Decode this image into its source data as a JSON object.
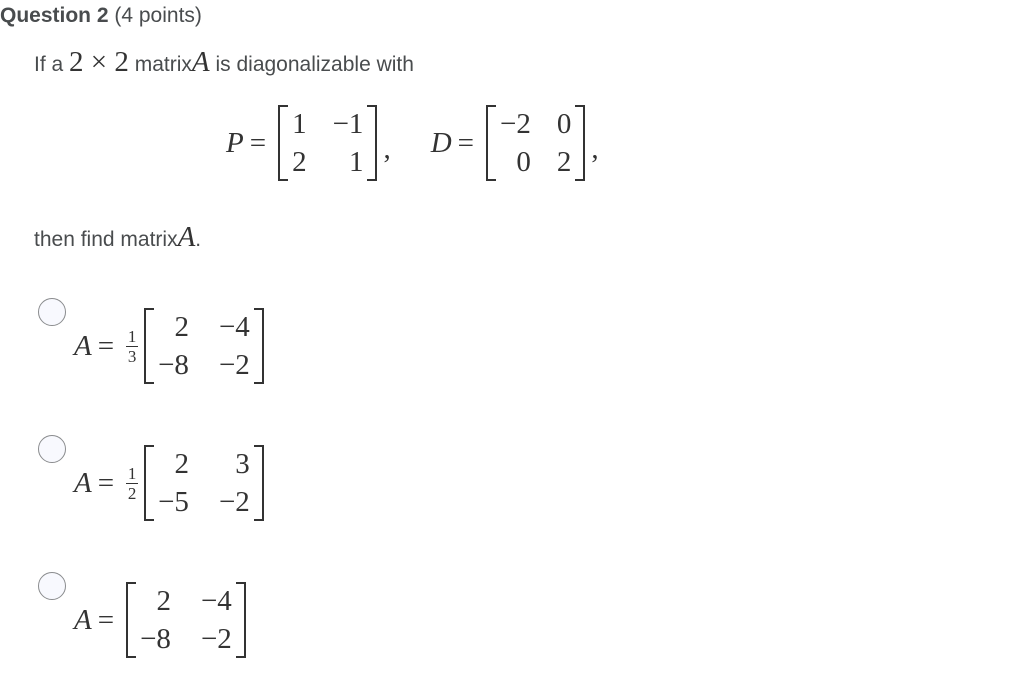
{
  "question": {
    "label": "Question 2",
    "points": "(4 points)"
  },
  "prompt": {
    "pre": "If a",
    "dims": "2 × 2",
    "mid": "matrix",
    "var": "A",
    "post": "is diagonalizable with"
  },
  "given": {
    "P": {
      "name": "P",
      "equals": "=",
      "rows": [
        [
          "1",
          "−1"
        ],
        [
          "2",
          "1"
        ]
      ]
    },
    "D": {
      "name": "D",
      "equals": "=",
      "rows": [
        [
          "−2",
          "0"
        ],
        [
          "0",
          "2"
        ]
      ]
    },
    "sep": ",",
    "end": ","
  },
  "then": {
    "text": "then find matrix",
    "var": "A",
    "end": "."
  },
  "options": [
    {
      "lhs": "A",
      "equals": "=",
      "has_frac": true,
      "num": "1",
      "den": "3",
      "rows": [
        [
          "2",
          "−4"
        ],
        [
          "−8",
          "−2"
        ]
      ],
      "selected": false
    },
    {
      "lhs": "A",
      "equals": "=",
      "has_frac": true,
      "num": "1",
      "den": "2",
      "rows": [
        [
          "2",
          "3"
        ],
        [
          "−5",
          "−2"
        ]
      ],
      "selected": false
    },
    {
      "lhs": "A",
      "equals": "=",
      "has_frac": false,
      "num": "",
      "den": "",
      "rows": [
        [
          "2",
          "−4"
        ],
        [
          "−8",
          "−2"
        ]
      ],
      "selected": false
    }
  ]
}
